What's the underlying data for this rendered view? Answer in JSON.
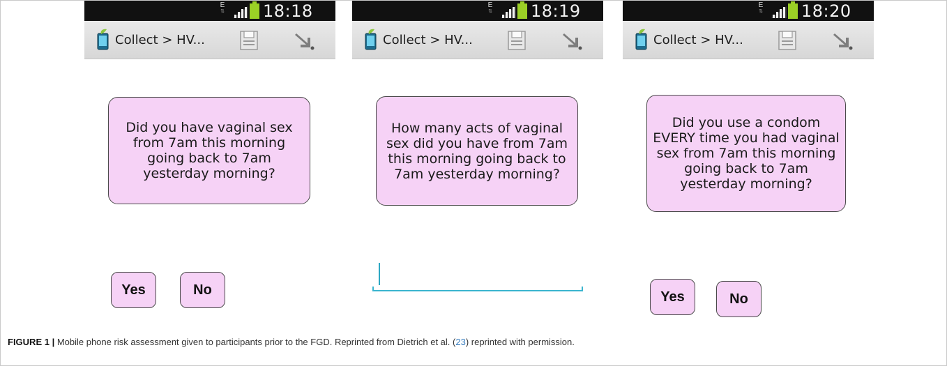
{
  "screens": [
    {
      "status": {
        "network": "E",
        "time": "18:18"
      },
      "action_bar": {
        "title": "Collect > HV..."
      },
      "question": "Did you have vaginal sex from 7am this morning going back to 7am yesterday morning?",
      "answers": [
        "Yes",
        "No"
      ]
    },
    {
      "status": {
        "network": "E",
        "time": "18:19"
      },
      "action_bar": {
        "title": "Collect > HV..."
      },
      "question": "How many acts of vaginal sex did you have from 7am this morning going back to 7am yesterday morning?",
      "input": {
        "value": ""
      }
    },
    {
      "status": {
        "network": "E",
        "time": "18:20"
      },
      "action_bar": {
        "title": "Collect > HV..."
      },
      "question": "Did you use a condom EVERY time you had vaginal sex from 7am this morning going back to 7am yesterday morning?",
      "answers": [
        "Yes",
        "No"
      ]
    }
  ],
  "caption": {
    "label": "FIGURE 1 |",
    "text_before_ref": " Mobile phone risk assessment given to participants prior to the FGD. Reprinted from Dietrich et al. (",
    "ref": "23",
    "text_after_ref": ") reprinted with permission."
  },
  "colors": {
    "question_fill": "#f6d2f6",
    "status_bar": "#111111",
    "battery": "#9bd026",
    "input_underline": "#3bb5cf"
  },
  "icons": [
    "app-icon",
    "save-icon",
    "navigation-arrow-icon",
    "signal-icon",
    "battery-icon"
  ]
}
